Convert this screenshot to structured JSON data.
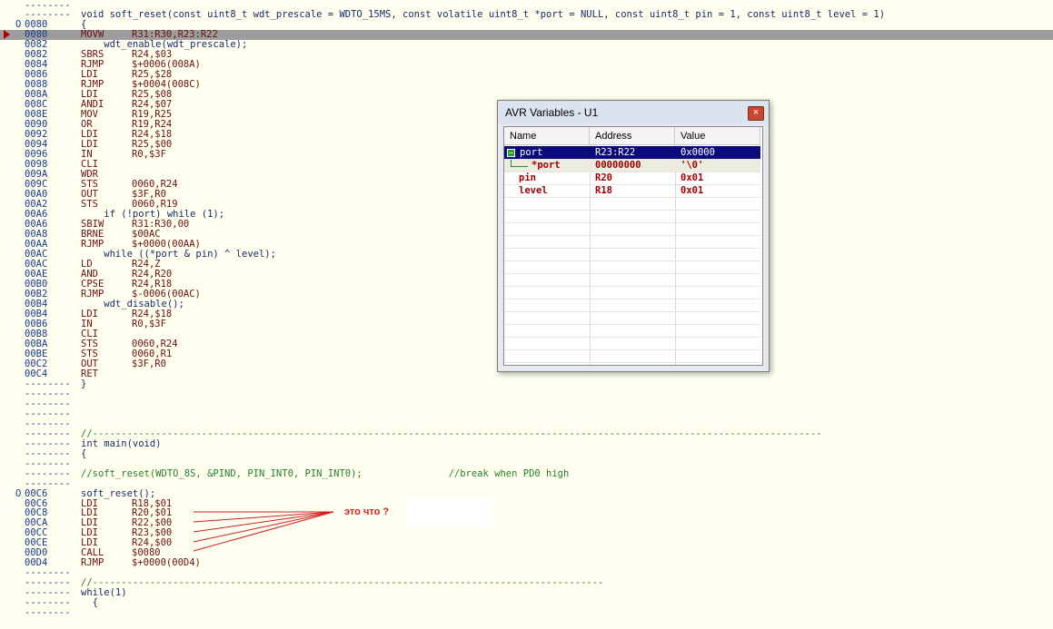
{
  "code_lines": [
    {
      "addr": "--------",
      "text": ""
    },
    {
      "addr": "--------",
      "text": "void soft_reset(const uint8_t wdt_prescale = WDTO_15MS, const volatile uint8_t *port = NULL, const uint8_t pin = 1, const uint8_t level = 1)",
      "type": "src"
    },
    {
      "addr": "0080",
      "mark": "O",
      "text": "{",
      "type": "src"
    },
    {
      "addr": "0080",
      "mn": "MOVW",
      "op": "R31:R30,R23:R22",
      "highlight": true
    },
    {
      "addr": "0082",
      "text": "    wdt_enable(wdt_prescale);",
      "type": "src"
    },
    {
      "addr": "0082",
      "mn": "SBRS",
      "op": "R24,$03"
    },
    {
      "addr": "0084",
      "mn": "RJMP",
      "op": "$+0006(008A)"
    },
    {
      "addr": "0086",
      "mn": "LDI",
      "op": "R25,$28"
    },
    {
      "addr": "0088",
      "mn": "RJMP",
      "op": "$+0004(008C)"
    },
    {
      "addr": "008A",
      "mn": "LDI",
      "op": "R25,$08"
    },
    {
      "addr": "008C",
      "mn": "ANDI",
      "op": "R24,$07"
    },
    {
      "addr": "008E",
      "mn": "MOV",
      "op": "R19,R25"
    },
    {
      "addr": "0090",
      "mn": "OR",
      "op": "R19,R24"
    },
    {
      "addr": "0092",
      "mn": "LDI",
      "op": "R24,$18"
    },
    {
      "addr": "0094",
      "mn": "LDI",
      "op": "R25,$00"
    },
    {
      "addr": "0096",
      "mn": "IN",
      "op": "R0,$3F"
    },
    {
      "addr": "0098",
      "mn": "CLI",
      "op": ""
    },
    {
      "addr": "009A",
      "mn": "WDR",
      "op": ""
    },
    {
      "addr": "009C",
      "mn": "STS",
      "op": "0060,R24"
    },
    {
      "addr": "00A0",
      "mn": "OUT",
      "op": "$3F,R0"
    },
    {
      "addr": "00A2",
      "mn": "STS",
      "op": "0060,R19"
    },
    {
      "addr": "00A6",
      "text": "    if (!port) while (1);",
      "type": "src"
    },
    {
      "addr": "00A6",
      "mn": "SBIW",
      "op": "R31:R30,00"
    },
    {
      "addr": "00A8",
      "mn": "BRNE",
      "op": "$00AC"
    },
    {
      "addr": "00AA",
      "mn": "RJMP",
      "op": "$+0000(00AA)"
    },
    {
      "addr": "00AC",
      "text": "    while ((*port & pin) ^ level);",
      "type": "src"
    },
    {
      "addr": "00AC",
      "mn": "LD",
      "op": "R24,Z"
    },
    {
      "addr": "00AE",
      "mn": "AND",
      "op": "R24,R20"
    },
    {
      "addr": "00B0",
      "mn": "CPSE",
      "op": "R24,R18"
    },
    {
      "addr": "00B2",
      "mn": "RJMP",
      "op": "$-0006(00AC)"
    },
    {
      "addr": "00B4",
      "text": "    wdt_disable();",
      "type": "src"
    },
    {
      "addr": "00B4",
      "mn": "LDI",
      "op": "R24,$18"
    },
    {
      "addr": "00B6",
      "mn": "IN",
      "op": "R0,$3F"
    },
    {
      "addr": "00B8",
      "mn": "CLI",
      "op": ""
    },
    {
      "addr": "00BA",
      "mn": "STS",
      "op": "0060,R24"
    },
    {
      "addr": "00BE",
      "mn": "STS",
      "op": "0060,R1"
    },
    {
      "addr": "00C2",
      "mn": "OUT",
      "op": "$3F,R0"
    },
    {
      "addr": "00C4",
      "mn": "RET",
      "op": ""
    },
    {
      "addr": "--------",
      "text": "}",
      "type": "src"
    },
    {
      "addr": "--------",
      "text": ""
    },
    {
      "addr": "--------",
      "text": ""
    },
    {
      "addr": "--------",
      "text": ""
    },
    {
      "addr": "--------",
      "text": ""
    },
    {
      "addr": "--------",
      "text": "//-------------------------------------------------------------------------------------------------------------------------------",
      "type": "comment"
    },
    {
      "addr": "--------",
      "text": "int main(void)",
      "type": "src"
    },
    {
      "addr": "--------",
      "text": "{",
      "type": "src"
    },
    {
      "addr": "--------",
      "text": ""
    },
    {
      "addr": "--------",
      "text": "//soft_reset(WDTO_8S, &PIND, PIN_INT0, PIN_INT0);               //break when PD0 high",
      "type": "comment"
    },
    {
      "addr": "--------",
      "text": ""
    },
    {
      "addr": "00C6",
      "mark": "O",
      "text": "soft_reset();",
      "type": "src"
    },
    {
      "addr": "00C6",
      "mn": "LDI",
      "op": "R18,$01"
    },
    {
      "addr": "00C8",
      "mn": "LDI",
      "op": "R20,$01"
    },
    {
      "addr": "00CA",
      "mn": "LDI",
      "op": "R22,$00"
    },
    {
      "addr": "00CC",
      "mn": "LDI",
      "op": "R23,$00"
    },
    {
      "addr": "00CE",
      "mn": "LDI",
      "op": "R24,$00"
    },
    {
      "addr": "00D0",
      "mn": "CALL",
      "op": "$0080"
    },
    {
      "addr": "00D4",
      "mn": "RJMP",
      "op": "$+0000(00D4)"
    },
    {
      "addr": "--------",
      "text": ""
    },
    {
      "addr": "--------",
      "text": "//-----------------------------------------------------------------------------------------",
      "type": "comment"
    },
    {
      "addr": "--------",
      "text": "while(1)",
      "type": "src"
    },
    {
      "addr": "--------",
      "text": "  {",
      "type": "src"
    },
    {
      "addr": "--------",
      "text": ""
    }
  ],
  "window": {
    "title": "AVR Variables - U1",
    "close_glyph": "×",
    "columns": [
      "Name",
      "Address",
      "Value"
    ],
    "expander_glyph": "−",
    "rows": [
      {
        "name": "port",
        "address": "R23:R22",
        "value": "0x0000",
        "selected": true
      },
      {
        "name": "*port",
        "address": "00000000",
        "value": "'\\0'",
        "sub": true
      },
      {
        "name": "pin",
        "address": "R20",
        "value": "0x01"
      },
      {
        "name": "level",
        "address": "R18",
        "value": "0x01"
      }
    ]
  },
  "annotation": {
    "text": "это что ?",
    "color": "#d02020"
  }
}
